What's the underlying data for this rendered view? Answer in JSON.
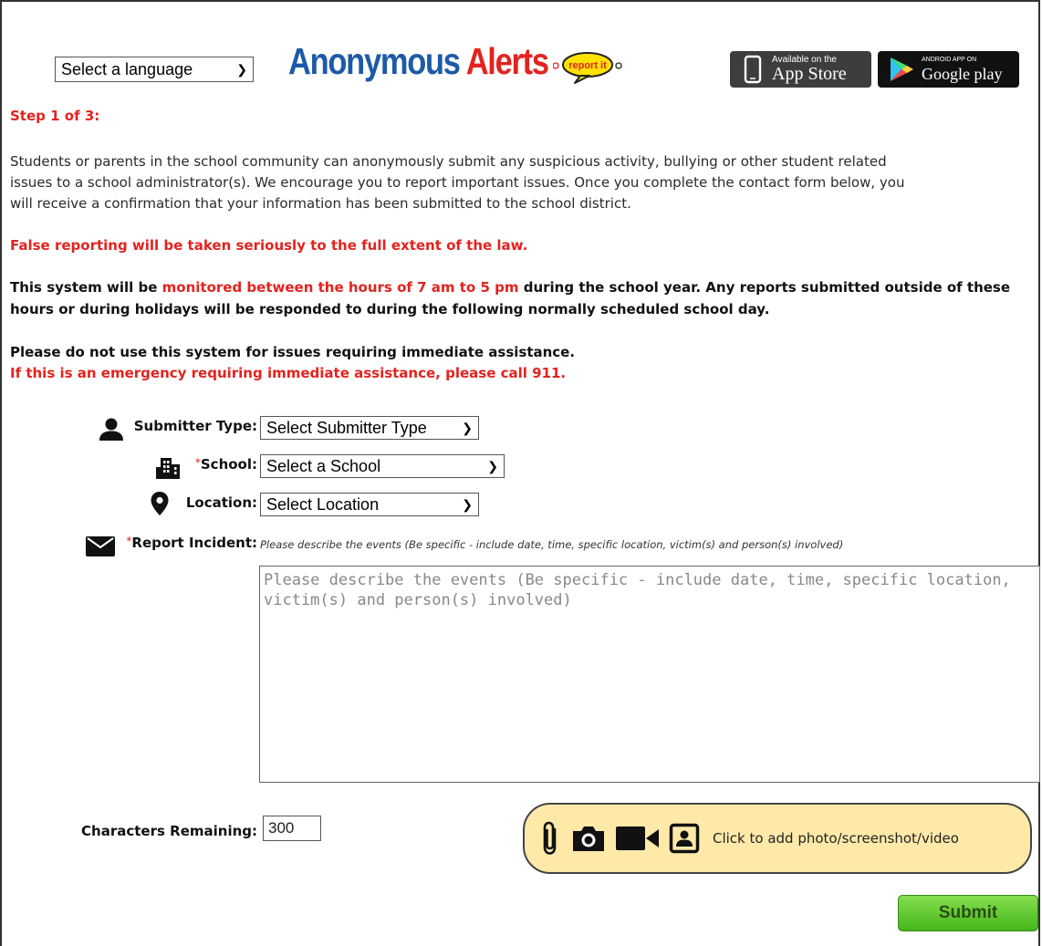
{
  "header": {
    "language_select": "Select a language",
    "logo_part1": "Anonymous",
    "logo_part2": "Alerts",
    "bubble_text": "report it",
    "appstore_small": "Available on the",
    "appstore_big": "App Store",
    "gplay_small": "ANDROID APP ON",
    "gplay_big": "Google play"
  },
  "content": {
    "step": "Step 1 of 3:",
    "intro_line1": "Students or parents in the school community can anonymously submit any suspicious activity, bullying or other student related",
    "intro_line2": "issues to a school administrator(s). We encourage you to report important issues. Once you complete the contact form below, you",
    "intro_line3": "will receive a confirmation that your information has been submitted to the school district.",
    "false_reporting": "False reporting will be taken seriously to the full extent of the law.",
    "monitor_pre": "This system will be ",
    "monitor_red": "monitored between the hours of 7 am to 5 pm",
    "monitor_post": " during the school year. Any reports submitted outside of these",
    "monitor_line2": "hours or during holidays will be responded to during the following normally scheduled school day.",
    "immediate": "Please do not use this system for issues requiring immediate assistance.",
    "emergency": "If this is an emergency requiring immediate assistance, please call 911."
  },
  "form": {
    "submitter_label": "Submitter Type:",
    "submitter_value": "Select Submitter Type",
    "school_star": "*",
    "school_label": "School:",
    "school_value": "Select a School",
    "location_label": "Location:",
    "location_value": "Select Location",
    "report_star": "*",
    "report_label": "Report Incident:",
    "report_hint": "Please describe the events (Be specific - include date, time, specific location, victim(s) and person(s) involved)",
    "report_placeholder": "Please describe the events (Be specific - include date, time, specific location, victim(s) and person(s) involved)",
    "chars_label": "Characters Remaining:",
    "chars_value": "300",
    "attach_text": "Click to add photo/screenshot/video",
    "submit_label": "Submit"
  },
  "colors": {
    "accent_red": "#e3231f",
    "logo_blue": "#1d5aa8",
    "submit_green": "#45b61a",
    "attach_bg": "#ffe9a9"
  },
  "icons": [
    "person-icon",
    "building-icon",
    "location-pin-icon",
    "envelope-icon",
    "paperclip-icon",
    "camera-icon",
    "video-icon",
    "contact-card-icon",
    "apple-phone-icon",
    "google-play-icon"
  ]
}
